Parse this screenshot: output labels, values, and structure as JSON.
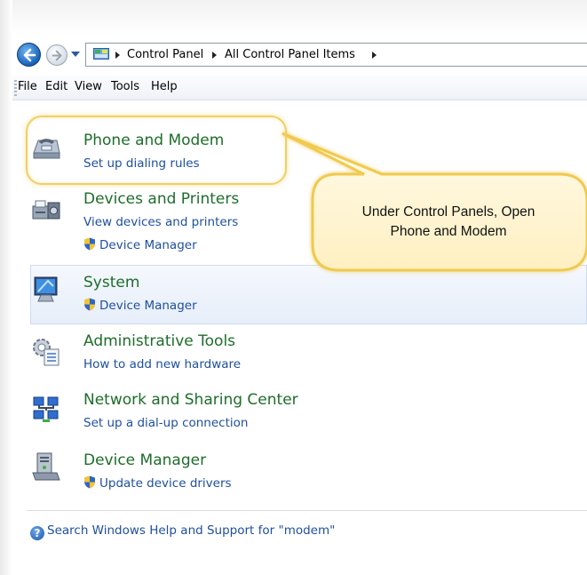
{
  "address": {
    "crumbs": [
      "Control Panel",
      "All Control Panel Items"
    ]
  },
  "menu": [
    "File",
    "Edit",
    "View",
    "Tools",
    "Help"
  ],
  "items": [
    {
      "title": "Phone and Modem",
      "links": [
        "Set up dialing rules"
      ],
      "icon": "phone-modem-icon"
    },
    {
      "title": "Devices and Printers",
      "links": [
        "View devices and printers",
        "Device Manager"
      ],
      "icon": "printer-icon"
    },
    {
      "title": "System",
      "links": [
        "Device Manager"
      ],
      "icon": "system-computer-icon"
    },
    {
      "title": "Administrative Tools",
      "links": [
        "How to add new hardware"
      ],
      "icon": "admin-tools-icon"
    },
    {
      "title": "Network and Sharing Center",
      "links": [
        "Set up a dial-up connection"
      ],
      "icon": "network-icon"
    },
    {
      "title": "Device Manager",
      "links": [
        "Update device drivers"
      ],
      "icon": "device-manager-icon"
    }
  ],
  "help": {
    "text": "Search Windows Help and Support for \"modem\""
  },
  "callout": {
    "line1": "Under Control Panels, Open",
    "line2": "Phone and Modem"
  },
  "colors": {
    "title_green": "#1e6d2a",
    "link_blue": "#1f4fa0",
    "callout_border": "#f2cf63"
  }
}
